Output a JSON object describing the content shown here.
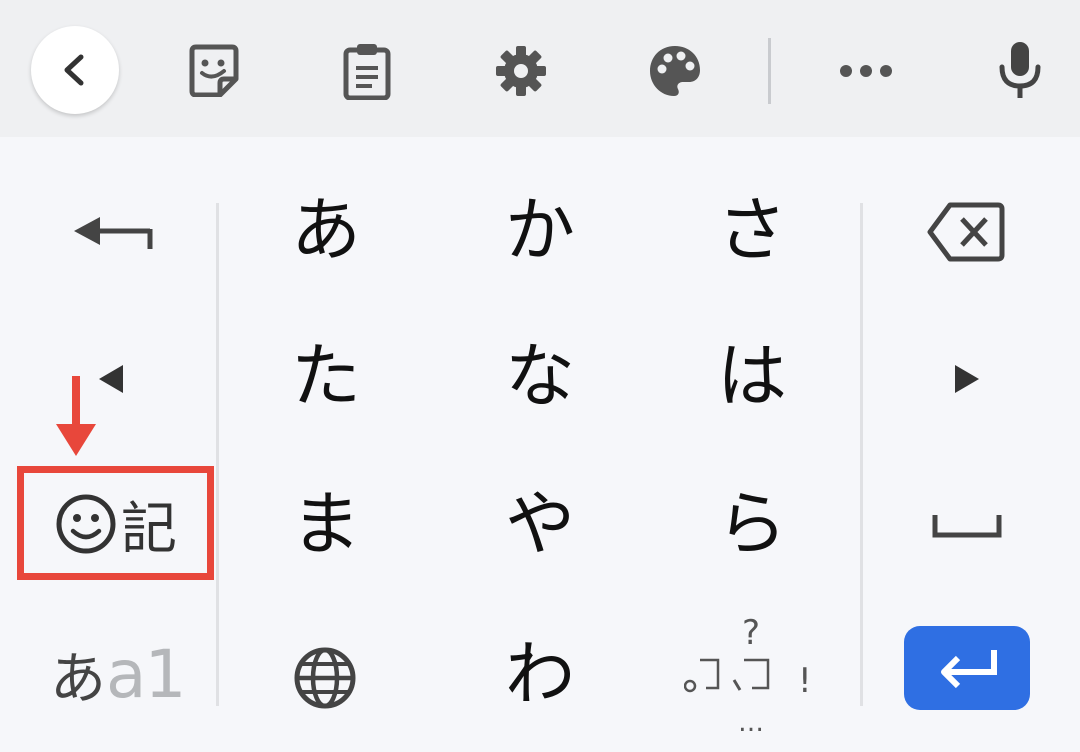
{
  "toolbar": {
    "icons": [
      "back-chevron-icon",
      "sticker-icon",
      "clipboard-icon",
      "settings-gear-icon",
      "palette-icon",
      "more-dots-icon",
      "microphone-icon"
    ]
  },
  "keyboard": {
    "rows": [
      [
        "あ",
        "か",
        "さ"
      ],
      [
        "た",
        "な",
        "は"
      ],
      [
        "ま",
        "や",
        "ら"
      ],
      [
        "",
        "わ",
        ""
      ]
    ],
    "emoji_key": {
      "label": "記",
      "icon": "smiley-icon"
    },
    "mode_toggle": {
      "kana": "あ",
      "alpha": "a1"
    },
    "punctuation": {
      "top": "?",
      "middle": "。、",
      "right": "!",
      "bottom": "…"
    },
    "left_icons": [
      "undo-arrow-icon",
      "cursor-left-icon"
    ],
    "right_icons": [
      "backspace-icon",
      "cursor-right-icon",
      "space-icon",
      "enter-icon"
    ],
    "globe_icon": "globe-icon"
  },
  "annotation": {
    "color": "#e8473b",
    "target": "emoji-key"
  },
  "colors": {
    "enter_button": "#2f6fe3",
    "toolbar_bg": "#eff0f2",
    "keyboard_bg": "#f6f7fa"
  }
}
